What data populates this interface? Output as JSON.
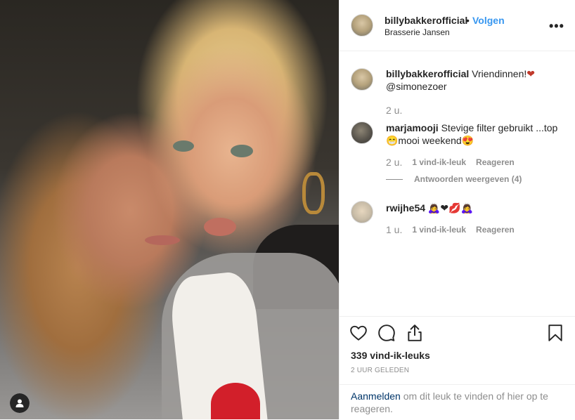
{
  "post": {
    "username": "billybakkerofficial",
    "separator": "•",
    "follow_label": "Volgen",
    "location": "Brasserie Jansen",
    "more_label": "•••"
  },
  "caption": {
    "username": "billybakkerofficial",
    "text": "Vriendinnen!",
    "emoji": "❤",
    "mention": "@simonezoer",
    "time": "2 u."
  },
  "comments": [
    {
      "username": "marjamooji",
      "text": "Stevige filter gebruikt ...top😁mooi weekend😍",
      "time": "2 u.",
      "likes": "1 vind-ik-leuk",
      "reply_label": "Reageren",
      "view_replies": "Antwoorden weergeven (4)"
    },
    {
      "username": "rwijhe54",
      "text": "🙇‍♀️❤💋🙇‍♀️",
      "time": "1 u.",
      "likes": "1 vind-ik-leuk",
      "reply_label": "Reageren"
    }
  ],
  "actions": {
    "likes_count": "339 vind-ik-leuks",
    "posted_ago": "2 UUR GELEDEN"
  },
  "login": {
    "link": "Aanmelden",
    "text": " om dit leuk te vinden of hier op te reageren."
  },
  "icons": [
    "heart-icon",
    "comment-icon",
    "share-icon",
    "bookmark-icon",
    "user-icon",
    "more-icon"
  ],
  "colors": {
    "accent": "#3897f0",
    "text": "#262626",
    "muted": "#8e8e8e",
    "link": "#003569"
  }
}
